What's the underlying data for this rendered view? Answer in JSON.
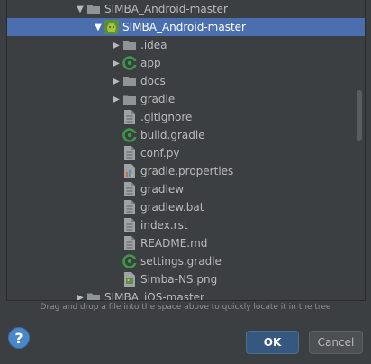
{
  "tree": {
    "items": [
      {
        "label": "SIMBA_Android-master",
        "kind": "folder",
        "expanded": true,
        "level": 0
      },
      {
        "label": "SIMBA_Android-master",
        "kind": "android-module",
        "expanded": true,
        "level": 1,
        "selected": true
      },
      {
        "label": ".idea",
        "kind": "folder",
        "expanded": false,
        "level": 2
      },
      {
        "label": "app",
        "kind": "gradle-module",
        "expanded": false,
        "level": 2
      },
      {
        "label": "docs",
        "kind": "folder",
        "expanded": false,
        "level": 2
      },
      {
        "label": "gradle",
        "kind": "folder",
        "expanded": false,
        "level": 2
      },
      {
        "label": ".gitignore",
        "kind": "file",
        "level": 2
      },
      {
        "label": "build.gradle",
        "kind": "gradle-file",
        "level": 2
      },
      {
        "label": "conf.py",
        "kind": "file",
        "level": 2
      },
      {
        "label": "gradle.properties",
        "kind": "properties-file",
        "level": 2
      },
      {
        "label": "gradlew",
        "kind": "file",
        "level": 2
      },
      {
        "label": "gradlew.bat",
        "kind": "file",
        "level": 2
      },
      {
        "label": "index.rst",
        "kind": "file",
        "level": 2
      },
      {
        "label": "README.md",
        "kind": "file",
        "level": 2
      },
      {
        "label": "settings.gradle",
        "kind": "gradle-file",
        "level": 2
      },
      {
        "label": "Simba-NS.png",
        "kind": "image-file",
        "level": 2
      },
      {
        "label": "SIMBA_iOS-master",
        "kind": "folder",
        "expanded": false,
        "level": 0
      }
    ]
  },
  "hint": "Drag and drop a file into the space above to quickly locate it in the tree",
  "buttons": {
    "help": "?",
    "ok": "OK",
    "cancel": "Cancel"
  },
  "colors": {
    "background": "#3c3f41",
    "selection": "#4b6eaf",
    "folder": "#8f9497",
    "android": "#a4c639",
    "gradle": "#3d9a47",
    "ok_button": "#365880",
    "help_button": "#4a87c8"
  }
}
